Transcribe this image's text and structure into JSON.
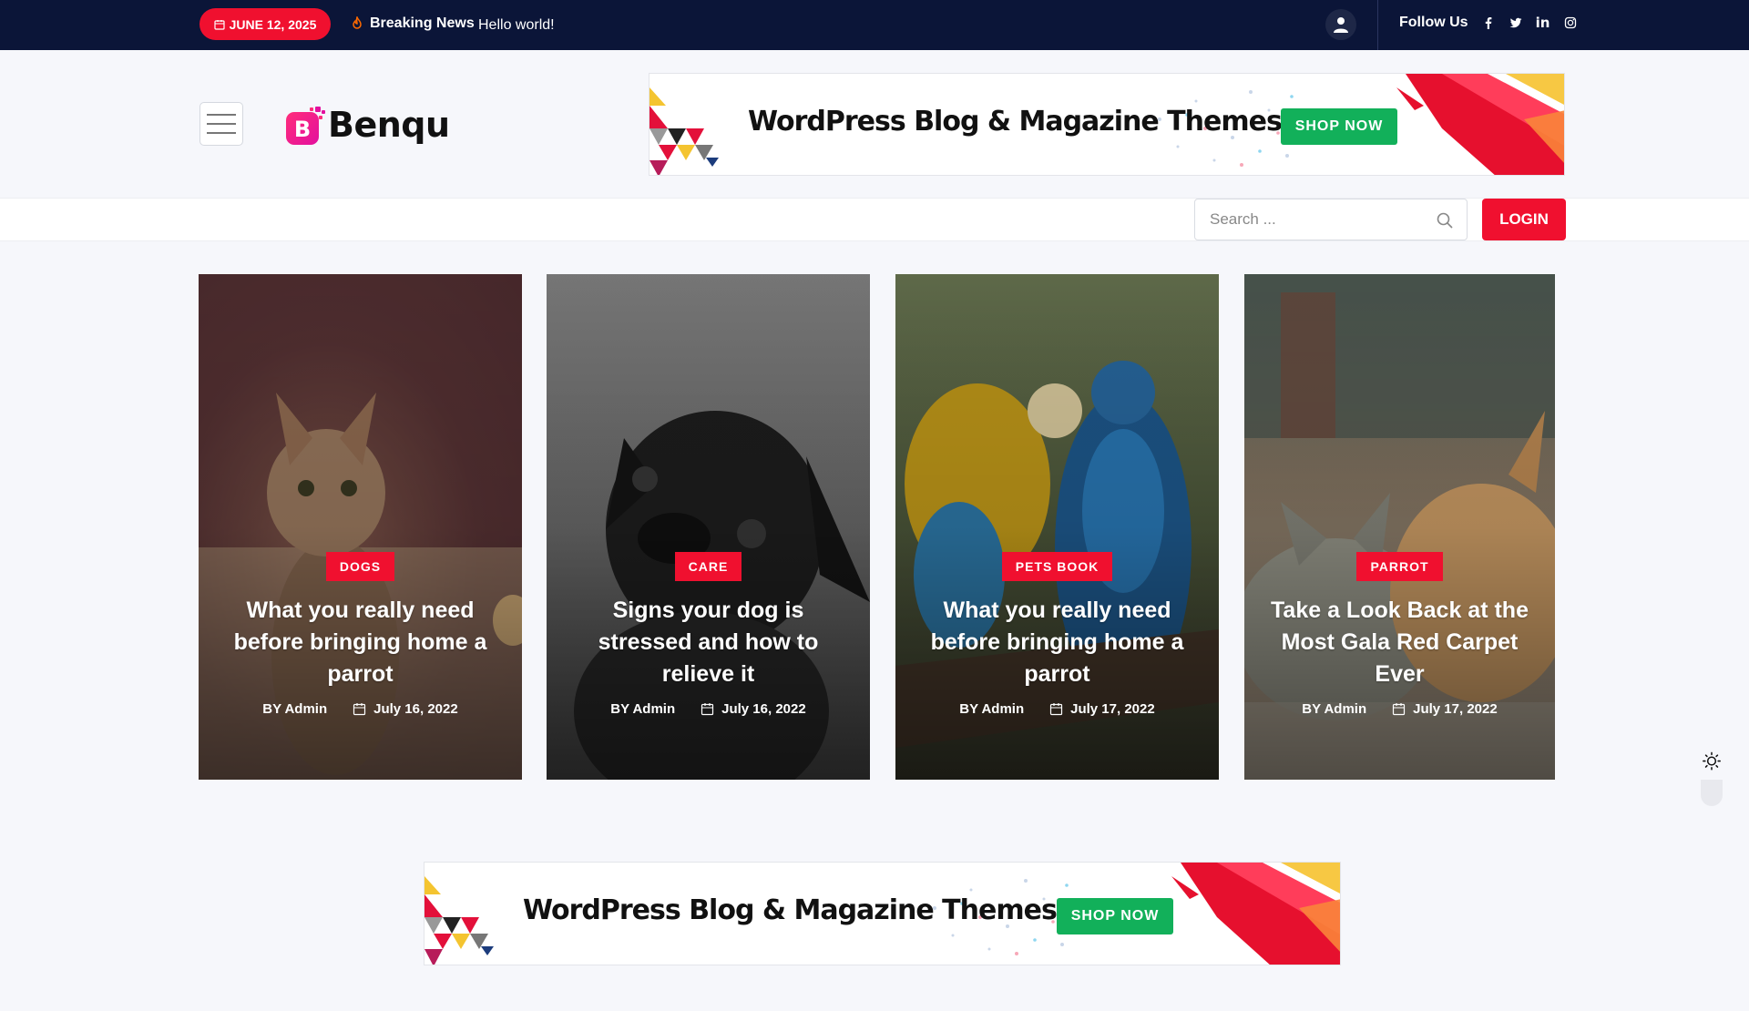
{
  "topbar": {
    "date": "JUNE 12, 2025",
    "breaking_label": "Breaking News",
    "ticker": "Hello world!",
    "follow_label": "Follow Us",
    "social": [
      "facebook-icon",
      "twitter-icon",
      "linkedin-icon",
      "instagram-icon"
    ],
    "linkedin_text": "in"
  },
  "header": {
    "logo_text": "Benqu",
    "logo_letter": "B"
  },
  "ads": {
    "top": {
      "title": "WordPress Blog & Magazine Themes",
      "cta": "SHOP NOW"
    },
    "bottom": {
      "title": "WordPress Blog & Magazine Themes",
      "cta": "SHOP NOW"
    }
  },
  "nav": {
    "search_placeholder": "Search ...",
    "login_label": "LOGIN"
  },
  "cards": [
    {
      "category": "DOGS",
      "title": "What you really need before bringing home a parrot",
      "author": "BY Admin",
      "date": "July 16, 2022"
    },
    {
      "category": "CARE",
      "title": "Signs your dog is stressed and how to relieve it",
      "author": "BY Admin",
      "date": "July 16, 2022"
    },
    {
      "category": "PETS BOOK",
      "title": "What you really need before bringing home a parrot",
      "author": "BY Admin",
      "date": "July 17, 2022"
    },
    {
      "category": "PARROT",
      "title": "Take a Look Back at the Most Gala Red Carpet Ever",
      "author": "BY Admin",
      "date": "July 17, 2022"
    }
  ],
  "colors": {
    "topbar_bg": "#0b1538",
    "accent_red": "#f0102f",
    "shop_green": "#12b05a",
    "logo_pink": "#ff1f8f"
  }
}
